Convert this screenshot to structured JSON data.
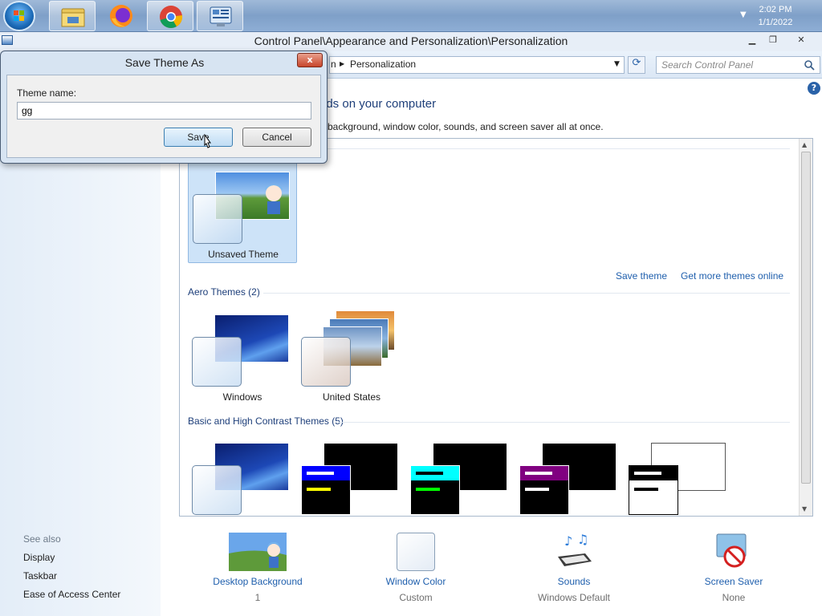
{
  "taskbar": {
    "apps": [
      {
        "name": "file-explorer",
        "active": true
      },
      {
        "name": "firefox",
        "active": false
      },
      {
        "name": "chrome",
        "active": true
      },
      {
        "name": "control-panel",
        "active": true
      }
    ],
    "time": "2:02 PM",
    "date": "1/1/2022"
  },
  "window": {
    "title": "Control Panel\\Appearance and Personalization\\Personalization",
    "breadcrumb_fragment": "n",
    "breadcrumb_current": "Personalization",
    "search_placeholder": "Search Control Panel"
  },
  "sidebar": {
    "see_also_label": "See also",
    "links": [
      "Display",
      "Taskbar",
      "Ease of Access Center"
    ]
  },
  "main": {
    "heading": "nds on your computer",
    "description": "p background, window color, sounds, and screen saver all at once."
  },
  "my_themes": {
    "items": [
      {
        "label": "Unsaved Theme",
        "selected": true
      }
    ],
    "save_theme_link": "Save theme",
    "get_more_link": "Get more themes online"
  },
  "aero_themes": {
    "title": "Aero Themes (2)",
    "items": [
      {
        "label": "Windows"
      },
      {
        "label": "United States"
      }
    ]
  },
  "basic_themes": {
    "title": "Basic and High Contrast Themes (5)"
  },
  "bottom": {
    "items": [
      {
        "label": "Desktop Background",
        "value": "1"
      },
      {
        "label": "Window Color",
        "value": "Custom"
      },
      {
        "label": "Sounds",
        "value": "Windows Default"
      },
      {
        "label": "Screen Saver",
        "value": "None"
      }
    ]
  },
  "dialog": {
    "title": "Save Theme As",
    "close_label": "x",
    "field_label": "Theme name:",
    "field_value": "gg",
    "save_label": "Save",
    "cancel_label": "Cancel"
  },
  "colors": {
    "link": "#1f5fad",
    "heading": "#1e3f7a",
    "selection": "#cde3f8"
  }
}
